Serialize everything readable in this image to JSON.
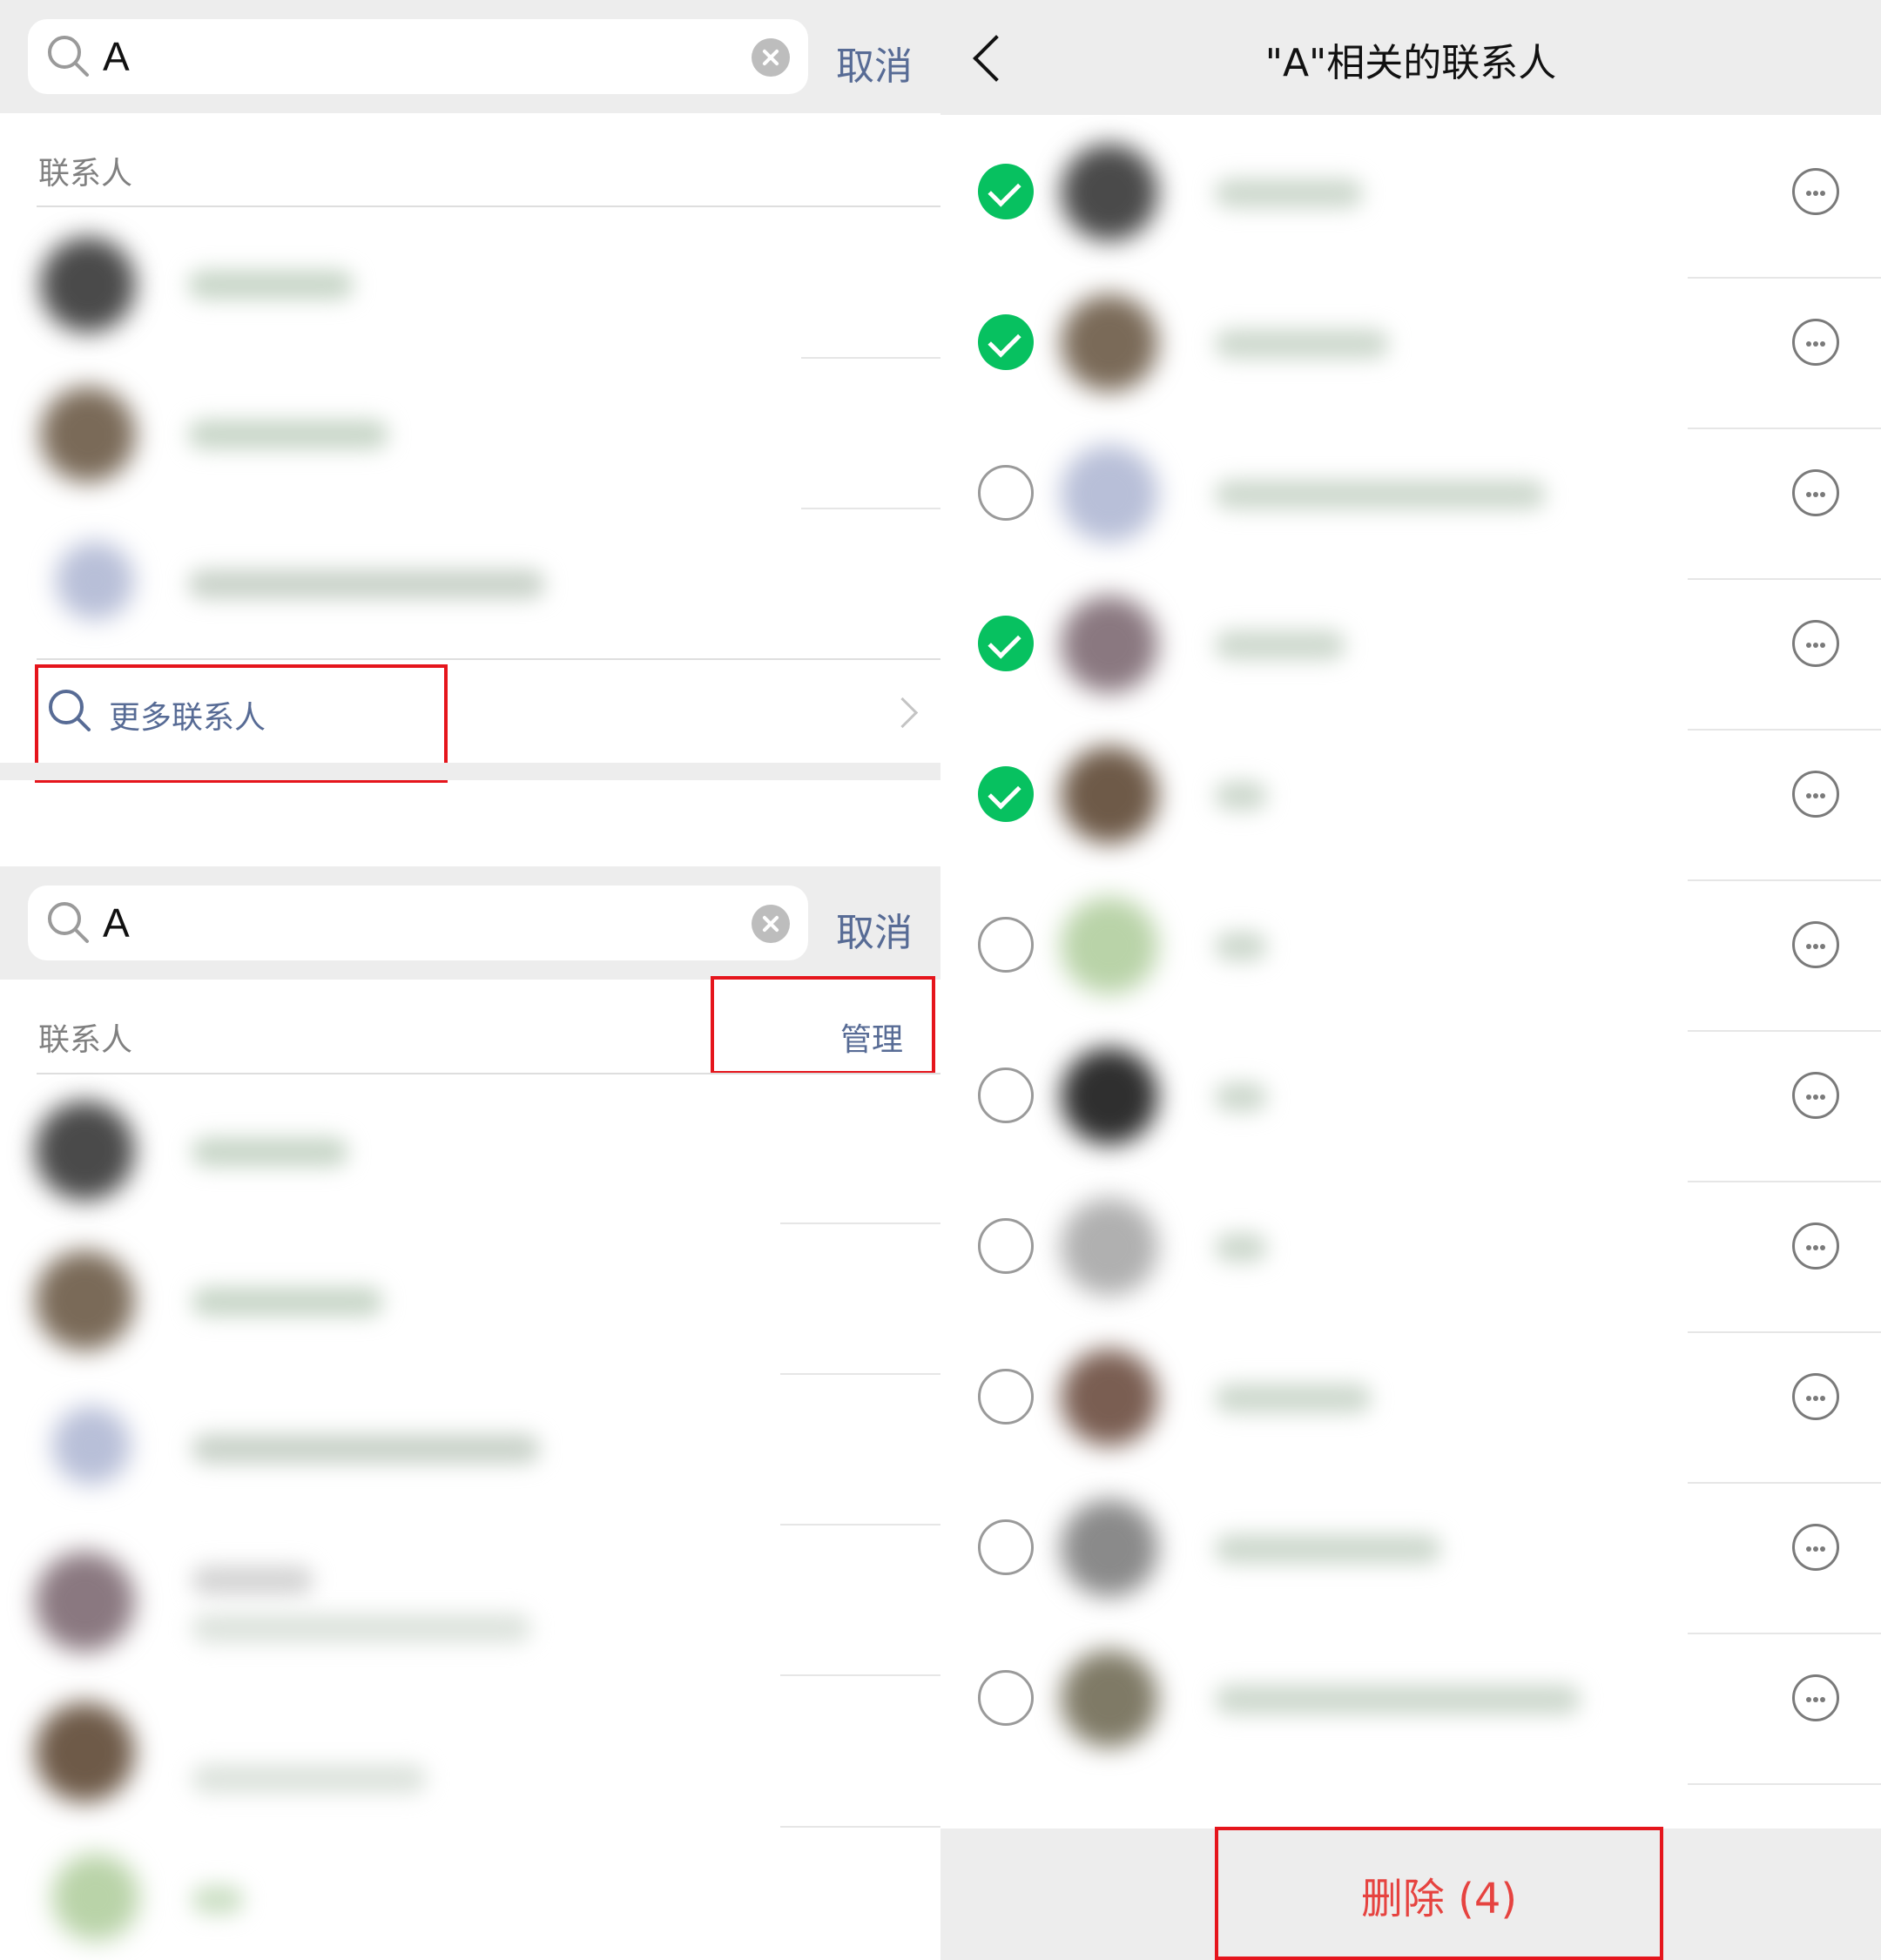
{
  "top_panel": {
    "search_query": "A",
    "cancel_label": "取消",
    "section_label": "联系人",
    "more_contacts_label": "更多联系人"
  },
  "middle_panel": {
    "search_query": "A",
    "cancel_label": "取消",
    "section_label": "联系人",
    "manage_label": "管理"
  },
  "right_panel": {
    "title": "\"A\"相关的联系人",
    "contacts": [
      {
        "selected": true
      },
      {
        "selected": true
      },
      {
        "selected": false
      },
      {
        "selected": true
      },
      {
        "selected": true
      },
      {
        "selected": false
      },
      {
        "selected": false
      },
      {
        "selected": false
      },
      {
        "selected": false
      },
      {
        "selected": false
      },
      {
        "selected": false
      }
    ],
    "delete_label": "删除 (4)"
  },
  "colors": {
    "accent_link": "#576b95",
    "check_green": "#07c160",
    "delete_red": "#e64340",
    "highlight_box": "#e5151c"
  }
}
